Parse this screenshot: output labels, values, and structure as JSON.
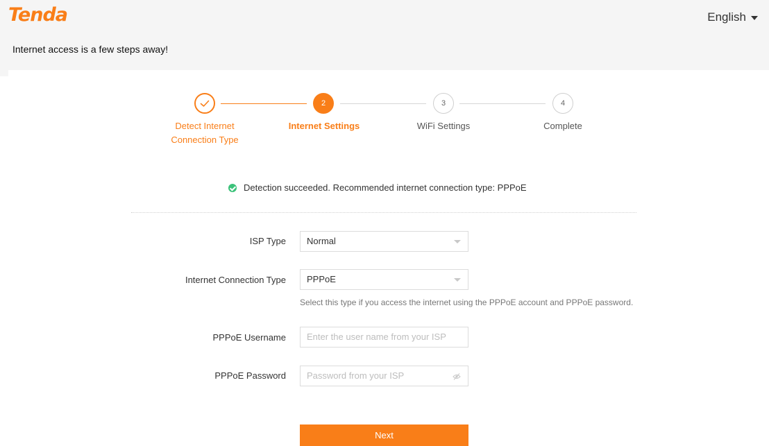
{
  "header": {
    "logo": "Tenda",
    "language": "English",
    "tagline": "Internet access is a few steps away!"
  },
  "steps": [
    {
      "number": "",
      "label_line1": "Detect Internet",
      "label_line2": "Connection Type",
      "state": "done"
    },
    {
      "number": "2",
      "label_line1": "Internet Settings",
      "label_line2": "",
      "state": "active"
    },
    {
      "number": "3",
      "label_line1": "WiFi Settings",
      "label_line2": "",
      "state": "todo"
    },
    {
      "number": "4",
      "label_line1": "Complete",
      "label_line2": "",
      "state": "todo"
    }
  ],
  "detection": {
    "message": "Detection succeeded. Recommended internet connection type: PPPoE",
    "icon": "success-check-icon",
    "color": "#3cc27a"
  },
  "form": {
    "isp_type": {
      "label": "ISP Type",
      "value": "Normal"
    },
    "connection_type": {
      "label": "Internet Connection Type",
      "value": "PPPoE",
      "hint": "Select this type if you access the internet using the PPPoE account and PPPoE password."
    },
    "username": {
      "label": "PPPoE Username",
      "placeholder": "Enter the user name from your ISP"
    },
    "password": {
      "label": "PPPoE Password",
      "placeholder": "Password from your ISP"
    }
  },
  "actions": {
    "next_label": "Next"
  },
  "colors": {
    "accent": "#f97e18",
    "success": "#3cc27a"
  }
}
